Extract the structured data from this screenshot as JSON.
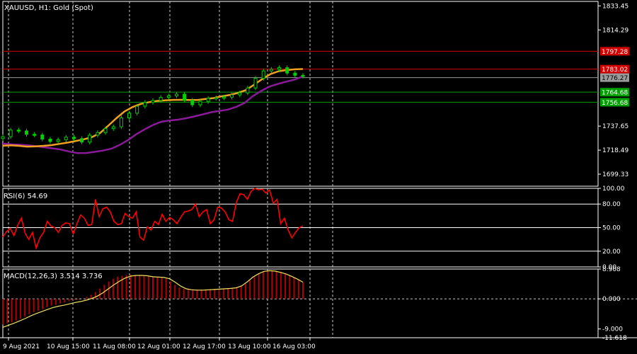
{
  "colors": {
    "background": "#000000",
    "foreground": "#ffffff",
    "grid": "#c8c8c8",
    "candle": "#00d000",
    "ma_fast": "#f0a020",
    "ma_slow": "#8a1a9a",
    "level_red": "#d40000",
    "level_gray": "#9a9a9a",
    "level_green": "#00a000",
    "rsi_line": "#ff0000",
    "macd_hist": "#b00000",
    "macd_signal": "#f0e060"
  },
  "chart_data": [
    {
      "type": "line",
      "title": "XAUUSD, H1:  Gold (Spot)",
      "series": [
        {
          "kind": "candlestick",
          "values": [
            1729.2,
            1734.5,
            1733.8,
            1731.1,
            1730.6,
            1727.3,
            1725.4,
            1726.8,
            1728.8,
            1727.7,
            1724.9,
            1730.4,
            1732.5,
            1735.6,
            1737.1,
            1744.2,
            1747.9,
            1753.5,
            1756.5,
            1758.0,
            1760.5,
            1761.7,
            1763.1,
            1758.3,
            1754.6,
            1757.3,
            1759.8,
            1760.2,
            1760.7,
            1762.5,
            1764.1,
            1768.0,
            1775.7,
            1781.6,
            1782.9,
            1784.2,
            1779.9,
            1778.1,
            1777.5
          ]
        },
        {
          "kind": "moving-average-fast",
          "values": [
            1722.0,
            1722.3,
            1721.9,
            1721.3,
            1721.5,
            1721.9,
            1722.5,
            1723.5,
            1724.5,
            1725.8,
            1727.1,
            1728.9,
            1732.2,
            1738.0,
            1743.9,
            1749.3,
            1752.8,
            1755.3,
            1756.7,
            1757.7,
            1758.2,
            1758.5,
            1758.6,
            1758.4,
            1758.4,
            1759.3,
            1760.0,
            1761.4,
            1762.5,
            1764.1,
            1766.4,
            1770.7,
            1775.2,
            1779.1,
            1781.4,
            1782.3,
            1782.9,
            1783.1
          ]
        },
        {
          "kind": "moving-average-slow",
          "values": [
            1723.8,
            1723.1,
            1722.8,
            1722.3,
            1721.6,
            1720.8,
            1719.9,
            1718.9,
            1717.3,
            1716.1,
            1716.2,
            1717.1,
            1718.1,
            1719.6,
            1722.6,
            1726.5,
            1731.1,
            1735.0,
            1738.5,
            1741.1,
            1742.1,
            1742.8,
            1743.9,
            1745.4,
            1747.0,
            1748.7,
            1749.7,
            1750.8,
            1753.0,
            1756.1,
            1761.6,
            1765.7,
            1769.2,
            1771.3,
            1773.1,
            1774.7,
            1777.3
          ]
        }
      ],
      "levels": [
        {
          "value": 1797.28,
          "label": "1797.28",
          "color_key": "level_red"
        },
        {
          "value": 1783.02,
          "label": "1783.02",
          "color_key": "level_red"
        },
        {
          "value": 1776.27,
          "label": "1776.27",
          "color_key": "level_gray"
        },
        {
          "value": 1764.68,
          "label": "1764.68",
          "color_key": "level_green"
        },
        {
          "value": 1756.68,
          "label": "1756.68",
          "color_key": "level_green"
        }
      ],
      "y_ticks": [
        "1833.45",
        "1814.29",
        "1737.65",
        "1718.49",
        "1699.33"
      ],
      "ylim": [
        1689.75,
        1837.0
      ]
    },
    {
      "type": "line",
      "title": "RSI(6) 54.69",
      "series": [
        {
          "values": [
            38,
            45,
            49,
            40,
            53,
            62,
            43,
            35,
            44,
            24,
            37,
            44,
            58,
            52,
            50,
            44,
            53,
            56,
            55,
            42,
            55,
            66,
            62,
            53,
            54,
            86,
            64,
            74,
            76,
            70,
            58,
            54,
            55,
            68,
            64,
            62,
            70,
            38,
            34,
            51,
            47,
            58,
            54,
            67,
            58,
            63,
            60,
            55,
            63,
            70,
            71,
            73,
            80,
            64,
            70,
            73,
            55,
            60,
            76,
            75,
            70,
            60,
            58,
            82,
            93,
            92,
            86,
            96,
            100,
            98,
            99,
            94,
            98,
            81,
            86,
            55,
            62,
            47,
            37,
            44,
            50,
            52
          ]
        }
      ],
      "y_ticks": [
        "100.00",
        "80.00",
        "50.00",
        "20.00",
        "0.00"
      ],
      "ylim": [
        0,
        100
      ]
    },
    {
      "type": "bar",
      "title": "MACD(12,26,3) 3.514 3.736",
      "series": [
        {
          "kind": "histogram",
          "values": [
            -7.7,
            -7.3,
            -7.0,
            -6.5,
            -5.9,
            -5.3,
            -4.6,
            -4.0,
            -3.6,
            -3.1,
            -2.5,
            -2.0,
            -1.8,
            -1.4,
            -1.1,
            -0.7,
            -0.4,
            -0.2,
            0.1,
            0.6,
            1.2,
            2.0,
            3.1,
            4.2,
            5.2,
            6.0,
            6.6,
            6.9,
            7.1,
            7.2,
            7.1,
            7.0,
            6.8,
            6.7,
            6.6,
            6.5,
            6.3,
            6.0,
            5.2,
            4.2,
            3.4,
            3.0,
            2.8,
            2.8,
            2.8,
            2.8,
            2.8,
            2.9,
            3.0,
            3.0,
            3.1,
            3.2,
            3.3,
            3.5,
            3.8,
            4.4,
            5.5,
            6.8,
            7.6,
            8.0,
            8.3,
            8.5,
            8.4,
            8.1,
            7.6,
            7.0,
            6.4,
            5.8,
            5.0
          ]
        },
        {
          "kind": "signal",
          "values": [
            -8.5,
            -7.9,
            -7.3,
            -6.6,
            -5.9,
            -5.1,
            -4.4,
            -3.8,
            -3.2,
            -2.6,
            -2.2,
            -1.9,
            -1.5,
            -1.1,
            -0.8,
            -0.4,
            0.1,
            0.8,
            1.8,
            3.0,
            4.2,
            5.3,
            6.2,
            6.8,
            7.0,
            7.0,
            6.9,
            6.6,
            6.5,
            6.4,
            6.0,
            5.0,
            3.8,
            3.0,
            2.7,
            2.6,
            2.6,
            2.7,
            2.8,
            2.9,
            3.0,
            3.1,
            3.3,
            3.9,
            5.1,
            6.5,
            7.5,
            8.2,
            8.4,
            8.3,
            7.9,
            7.4,
            6.7,
            5.9,
            5.0
          ]
        }
      ],
      "y_ticks": [
        "8.908",
        "0.000",
        "-9.000",
        "-11.618"
      ],
      "ylim": [
        -11.618,
        8.908
      ]
    }
  ],
  "time_axis": {
    "labels": [
      "9 Aug 2021",
      "10 Aug 15:00",
      "11 Aug 08:00",
      "12 Aug 01:00",
      "12 Aug 17:00",
      "13 Aug 10:00",
      "16 Aug 03:00"
    ]
  }
}
